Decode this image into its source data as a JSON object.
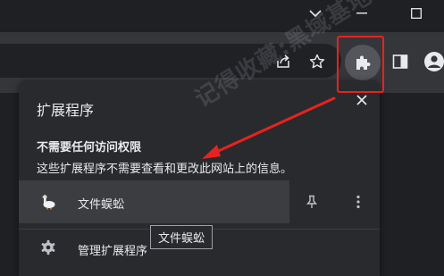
{
  "popup": {
    "title": "扩展程序",
    "close_icon": "close-icon",
    "section_heading": "不需要任何访问权限",
    "section_description": "这些扩展程序不需要查看和更改此网站上的信息。",
    "extensions": [
      {
        "name": "文件蜈蚣",
        "icon": "goose-icon"
      }
    ],
    "manage_label": "管理扩展程序"
  },
  "tooltip": {
    "text": "文件蜈蚣"
  },
  "watermark": {
    "text": "记得收藏:黑域基地 Hybase.com"
  },
  "toolbar": {
    "icons": [
      "share-icon",
      "bookmark-star-icon",
      "extensions-puzzle-icon",
      "side-panel-icon",
      "profile-icon"
    ]
  },
  "colors": {
    "annotation_red": "#e8221f",
    "popup_bg": "#292a2d",
    "toolbar_bg": "#35363a"
  }
}
